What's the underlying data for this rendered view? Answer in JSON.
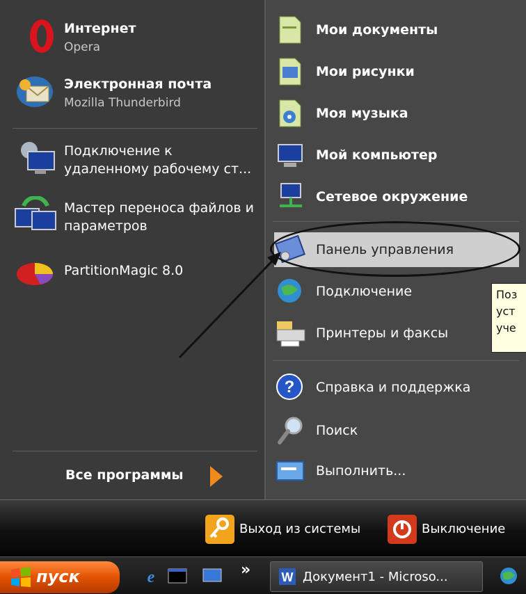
{
  "pinned": [
    {
      "title": "Интернет",
      "subtitle": "Opera",
      "icon": "opera-icon"
    },
    {
      "title": "Электронная почта",
      "subtitle": "Mozilla Thunderbird",
      "icon": "thunderbird-icon"
    }
  ],
  "recent": [
    {
      "line1": "Подключение к",
      "line2": "удаленному рабочему ст...",
      "icon": "remote-desktop-icon"
    },
    {
      "line1": "Мастер переноса файлов и",
      "line2": "параметров",
      "icon": "transfer-wizard-icon"
    },
    {
      "line1": "PartitionMagic 8.0",
      "line2": "",
      "icon": "partitionmagic-icon"
    }
  ],
  "all_programs": "Все программы",
  "places": [
    {
      "label": "Мои документы",
      "icon": "my-documents-icon",
      "bold": true
    },
    {
      "label": "Мои рисунки",
      "icon": "my-pictures-icon",
      "bold": true
    },
    {
      "label": "Моя музыка",
      "icon": "my-music-icon",
      "bold": true
    },
    {
      "label": "Мой компьютер",
      "icon": "my-computer-icon",
      "bold": true
    },
    {
      "label": "Сетевое окружение",
      "icon": "network-places-icon",
      "bold": true
    }
  ],
  "system": [
    {
      "label": "Панель управления",
      "icon": "control-panel-icon"
    },
    {
      "label": "Подключение",
      "icon": "connect-icon"
    },
    {
      "label": "Принтеры и факсы",
      "icon": "printers-icon"
    }
  ],
  "support": [
    {
      "label": "Справка и поддержка",
      "icon": "help-icon"
    },
    {
      "label": "Поиск",
      "icon": "search-icon"
    },
    {
      "label": "Выполнить...",
      "icon": "run-icon"
    }
  ],
  "tooltip": [
    "Поз",
    "уст",
    "уче"
  ],
  "bottom": {
    "logoff": "Выход из системы",
    "shutdown": "Выключение"
  },
  "taskbar": {
    "start": "пуск",
    "quicklaunch": [
      "ie-icon",
      "cmd-icon",
      "desktop-icon"
    ],
    "task": "Документ1 - Microso..."
  },
  "colors": {
    "start": "#e35200",
    "panel_left": "#3a3a3a",
    "panel_right": "#474747",
    "highlight": "#cfcfcf",
    "tooltip": "#ffffe1"
  }
}
